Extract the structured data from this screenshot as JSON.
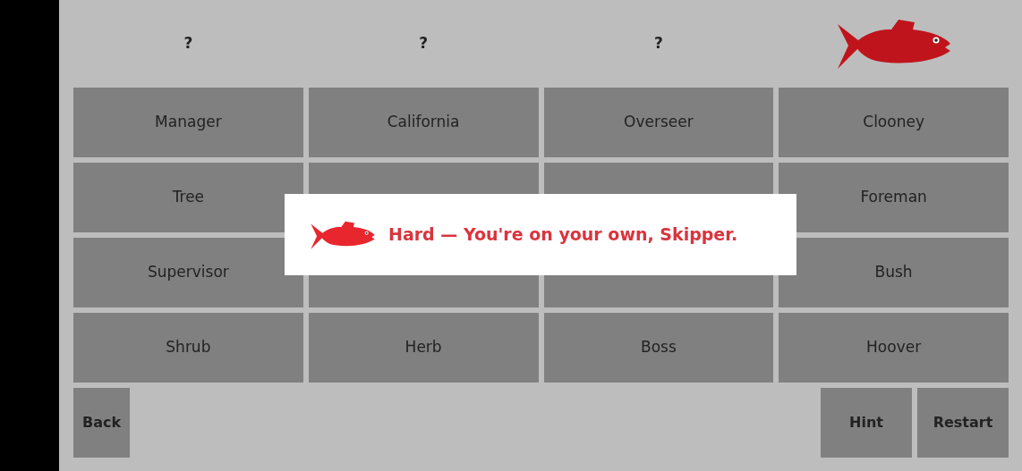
{
  "header": [
    {
      "kind": "unknown",
      "text": "?"
    },
    {
      "kind": "unknown",
      "text": "?"
    },
    {
      "kind": "unknown",
      "text": "?"
    },
    {
      "kind": "fish"
    }
  ],
  "tiles": [
    {
      "kind": "word",
      "label": "Manager"
    },
    {
      "kind": "word",
      "label": "California"
    },
    {
      "kind": "word",
      "label": "Overseer"
    },
    {
      "kind": "word",
      "label": "Clooney"
    },
    {
      "kind": "word",
      "label": "Tree"
    },
    {
      "kind": "covered"
    },
    {
      "kind": "covered"
    },
    {
      "kind": "word",
      "label": "Foreman"
    },
    {
      "kind": "word",
      "label": "Supervisor"
    },
    {
      "kind": "covered"
    },
    {
      "kind": "covered"
    },
    {
      "kind": "word",
      "label": "Bush"
    },
    {
      "kind": "word",
      "label": "Shrub"
    },
    {
      "kind": "word",
      "label": "Herb"
    },
    {
      "kind": "word",
      "label": "Boss"
    },
    {
      "kind": "word",
      "label": "Hoover"
    }
  ],
  "buttons": {
    "left": [
      "Back"
    ],
    "right": [
      "Hint",
      "Restart"
    ]
  },
  "toast": {
    "message": "Hard — You're on your own, Skipper."
  }
}
